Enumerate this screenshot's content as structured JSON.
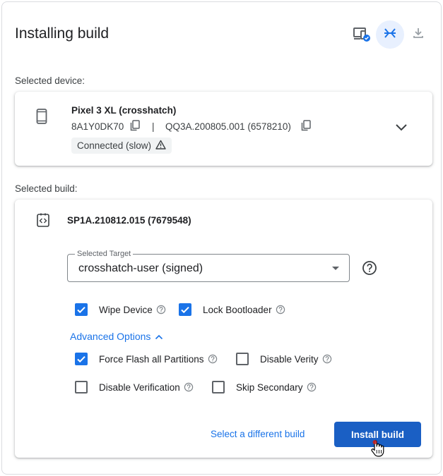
{
  "header": {
    "title": "Installing build",
    "actions": [
      {
        "icon": "device-settings-icon"
      },
      {
        "icon": "collapse-arrows-icon"
      },
      {
        "icon": "download-icon"
      }
    ]
  },
  "device_section": {
    "label": "Selected device:",
    "device": {
      "name": "Pixel 3 XL (crosshatch)",
      "serial": "8A1Y0DK70",
      "separator": "|",
      "build": "QQ3A.200805.001 (6578210)",
      "status": "Connected (slow)"
    }
  },
  "build_section": {
    "label": "Selected build:",
    "build_id": "SP1A.210812.015 (7679548)",
    "target": {
      "label": "Selected Target",
      "value": "crosshatch-user (signed)"
    },
    "options": [
      {
        "label": "Wipe Device",
        "checked": true
      },
      {
        "label": "Lock Bootloader",
        "checked": true
      }
    ],
    "advanced_toggle": "Advanced Options",
    "advanced_options": [
      {
        "label": "Force Flash all Partitions",
        "checked": true
      },
      {
        "label": "Disable Verity",
        "checked": false
      },
      {
        "label": "Disable Verification",
        "checked": false
      },
      {
        "label": "Skip Secondary",
        "checked": false
      }
    ],
    "select_different_label": "Select a different build",
    "install_label": "Install build"
  },
  "colors": {
    "accent": "#1a73e8",
    "install_button": "#1a5fc4",
    "collapse_bg": "#e8f0fe"
  }
}
